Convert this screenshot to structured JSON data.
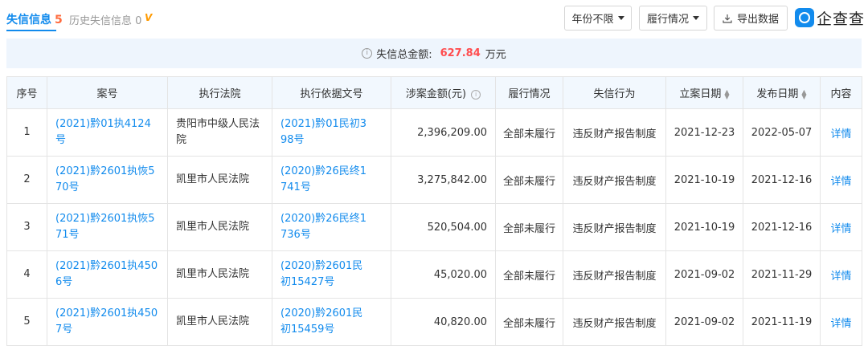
{
  "tabs": {
    "active_label": "失信信息",
    "active_count": "5",
    "history_label": "历史失信信息",
    "history_count": "0",
    "vip_glyph": "V"
  },
  "toolbar": {
    "year_filter": "年份不限",
    "performance_filter": "履行情况",
    "export_label": "导出数据"
  },
  "logo": {
    "text": "企查查"
  },
  "summary": {
    "label": "失信总金额:",
    "amount": "627.84",
    "unit": "万元"
  },
  "table": {
    "headers": {
      "index": "序号",
      "case_no": "案号",
      "court": "执行法院",
      "basis_no": "执行依据文号",
      "amount": "涉案金额(元)",
      "performance": "履行情况",
      "behavior": "失信行为",
      "filing_date": "立案日期",
      "publish_date": "发布日期",
      "content": "内容"
    },
    "rows": [
      {
        "index": "1",
        "case_no_1": "(2021)黔01执4124",
        "case_no_2": "号",
        "court_1": "贵阳市中级人民法",
        "court_2": "院",
        "basis_1": "(2021)黔01民初3",
        "basis_2": "98号",
        "amount": "2,396,209.00",
        "performance": "全部未履行",
        "behavior": "违反财产报告制度",
        "filing_date": "2021-12-23",
        "publish_date": "2022-05-07",
        "content": "详情"
      },
      {
        "index": "2",
        "case_no_1": "(2021)黔2601执恢5",
        "case_no_2": "70号",
        "court_1": "凯里市人民法院",
        "court_2": "",
        "basis_1": "(2020)黔26民终1",
        "basis_2": "741号",
        "amount": "3,275,842.00",
        "performance": "全部未履行",
        "behavior": "违反财产报告制度",
        "filing_date": "2021-10-19",
        "publish_date": "2021-12-16",
        "content": "详情"
      },
      {
        "index": "3",
        "case_no_1": "(2021)黔2601执恢5",
        "case_no_2": "71号",
        "court_1": "凯里市人民法院",
        "court_2": "",
        "basis_1": "(2020)黔26民终1",
        "basis_2": "736号",
        "amount": "520,504.00",
        "performance": "全部未履行",
        "behavior": "违反财产报告制度",
        "filing_date": "2021-10-19",
        "publish_date": "2021-12-16",
        "content": "详情"
      },
      {
        "index": "4",
        "case_no_1": "(2021)黔2601执450",
        "case_no_2": "6号",
        "court_1": "凯里市人民法院",
        "court_2": "",
        "basis_1": "(2020)黔2601民",
        "basis_2": "初15427号",
        "amount": "45,020.00",
        "performance": "全部未履行",
        "behavior": "违反财产报告制度",
        "filing_date": "2021-09-02",
        "publish_date": "2021-11-29",
        "content": "详情"
      },
      {
        "index": "5",
        "case_no_1": "(2021)黔2601执450",
        "case_no_2": "7号",
        "court_1": "凯里市人民法院",
        "court_2": "",
        "basis_1": "(2020)黔2601民",
        "basis_2": "初15459号",
        "amount": "40,820.00",
        "performance": "全部未履行",
        "behavior": "违反财产报告制度",
        "filing_date": "2021-09-02",
        "publish_date": "2021-11-19",
        "content": "详情"
      }
    ]
  },
  "colors": {
    "accent": "#128bed",
    "amount_red": "#ff4d4f",
    "count_orange": "#ff6b3d",
    "header_bg": "#f2f8fe",
    "summary_bg": "#eef5fd"
  }
}
